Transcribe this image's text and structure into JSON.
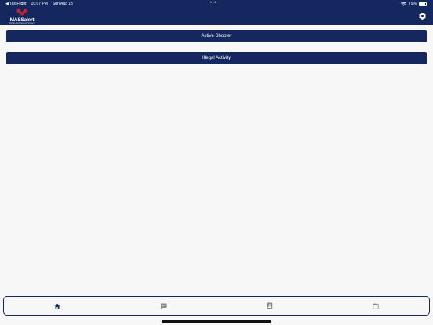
{
  "status_bar": {
    "back_app": "◀ TestFlight",
    "time": "10:07 PM",
    "date": "Sun Aug 13",
    "multitask_dots": "•••",
    "battery_percent": "79%",
    "battery_level": 0.79
  },
  "header": {
    "logo_text_mass": "MASS",
    "logo_text_alert": "alert",
    "logo_subtitle": "Mobile Alert Support System",
    "settings_icon": "gear-icon",
    "colors": {
      "bar": "#14285f",
      "logo_accent": "#d9263a"
    }
  },
  "actions": [
    {
      "label": "Active Shooter"
    },
    {
      "label": "Illegal Activity"
    }
  ],
  "tab_bar": {
    "tabs": [
      {
        "icon": "home-icon",
        "active": true
      },
      {
        "icon": "message-icon",
        "active": false
      },
      {
        "icon": "contacts-icon",
        "active": false
      },
      {
        "icon": "calendar-icon",
        "active": false
      }
    ],
    "active_color": "#14285f",
    "inactive_color": "#8a8a8e"
  }
}
